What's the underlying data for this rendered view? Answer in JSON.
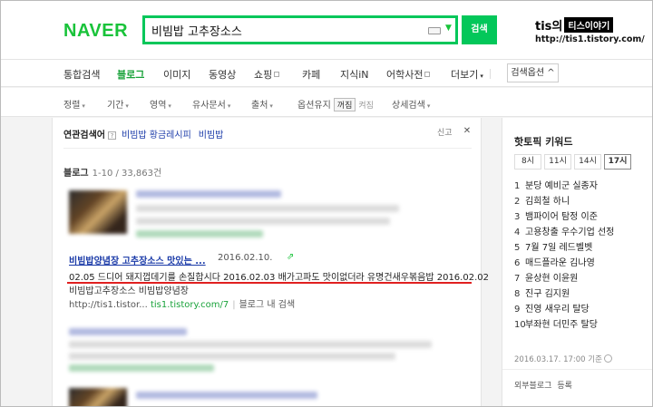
{
  "header": {
    "logo": "NAVER",
    "search_value": "비빔밥 고추장소스",
    "search_button": "검색",
    "watermark_name": "tis의",
    "watermark_tag": "티스이야기",
    "watermark_url": "http://tis1.tistory.com/"
  },
  "nav": {
    "items": [
      "통합검색",
      "블로그",
      "이미지",
      "동영상",
      "쇼핑",
      "카페",
      "지식iN",
      "어학사전",
      "더보기"
    ],
    "more_caret": "▾",
    "options_button": "검색옵션 ^"
  },
  "filters": {
    "items": [
      "정렬",
      "기간",
      "영역",
      "유사문서",
      "출처"
    ],
    "keep_label": "옵션유지",
    "toggle_on": "꺼짐",
    "toggle_off": "켜짐",
    "detail": "상세검색"
  },
  "related": {
    "label": "연관검색어",
    "help": "?",
    "terms": [
      "비빔밥 황금레시피",
      "비빔밥"
    ],
    "report": "신고",
    "close": "✕"
  },
  "results_header": {
    "title": "블로그",
    "count": "1-10 / 33,863건"
  },
  "result": {
    "title": "비빔밥양념장 고추장소스 맛있는 ...",
    "date": "2016.02.10.",
    "snippet": "02.05 드디어 돼지껍데기를 손질합시다 2016.02.03 배가고파도 맛이없더라 유명건새우볶음밥 2016.02.02",
    "blog_name": "비빔밥고추장소스 비빔밥양념장",
    "url_prefix": "http://tis1.tistor...",
    "url_green": "tis1.tistory.com/7",
    "url_suffix": "블로그 내 검색"
  },
  "side": {
    "title": "핫토픽 키워드",
    "tabs": [
      "8시",
      "11시",
      "14시",
      "17시"
    ],
    "active_tab": "17시",
    "keywords": [
      "분당 예비군 실종자",
      "김희철 하니",
      "뱀파이어 탐정 이준",
      "고용창출 우수기업 선정",
      "7월 7일 레드벨벳",
      "매드플라운 김나영",
      "윤상현 이윤원",
      "진구 김지원",
      "진영 새우리 탈당",
      "부좌현 더민주 탈당"
    ],
    "timestamp": "2016.03.17. 17:00 기준",
    "ext_label": "외부블로그",
    "ext_register": "등록"
  },
  "colors": {
    "brand_green": "#03c75a",
    "link_blue": "#1a3aa8",
    "highlight_red": "#e02020"
  }
}
